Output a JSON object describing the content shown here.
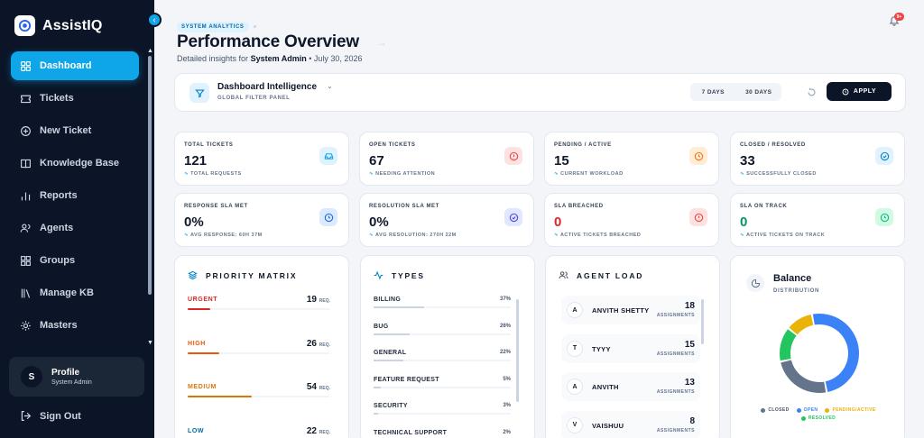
{
  "app": {
    "name": "AssistIQ"
  },
  "sidebar": {
    "items": [
      {
        "label": "Dashboard",
        "icon": "dashboard-icon"
      },
      {
        "label": "Tickets",
        "icon": "ticket-icon"
      },
      {
        "label": "New Ticket",
        "icon": "plus-circle-icon"
      },
      {
        "label": "Knowledge Base",
        "icon": "book-icon"
      },
      {
        "label": "Reports",
        "icon": "bar-chart-icon"
      },
      {
        "label": "Agents",
        "icon": "users-icon"
      },
      {
        "label": "Groups",
        "icon": "grid-icon"
      },
      {
        "label": "Manage KB",
        "icon": "library-icon"
      },
      {
        "label": "Masters",
        "icon": "gear-icon"
      }
    ],
    "profile": {
      "initial": "S",
      "name": "Profile",
      "role": "System Admin"
    },
    "signout": "Sign Out"
  },
  "header": {
    "badge": "SYSTEM ANALYTICS",
    "title": "Performance Overview",
    "subtitle_prefix": "Detailed insights for",
    "subtitle_user": "System Admin",
    "subtitle_date": "• July 30, 2026",
    "notifications": "9+"
  },
  "filter": {
    "title": "Dashboard Intelligence",
    "subtitle": "GLOBAL FILTER PANEL",
    "ranges": [
      "7 DAYS",
      "30 DAYS"
    ],
    "apply": "APPLY"
  },
  "stats": [
    {
      "label": "TOTAL TICKETS",
      "value": "121",
      "sub": "TOTAL REQUESTS",
      "color": "#0ea5e9",
      "bg": "#e0f2fe"
    },
    {
      "label": "OPEN TICKETS",
      "value": "67",
      "sub": "NEEDING ATTENTION",
      "color": "#ef4444",
      "bg": "#fee2e2"
    },
    {
      "label": "PENDING / ACTIVE",
      "value": "15",
      "sub": "CURRENT WORKLOAD",
      "color": "#f97316",
      "bg": "#ffedd5"
    },
    {
      "label": "CLOSED / RESOLVED",
      "value": "33",
      "sub": "SUCCESSFULLY CLOSED",
      "color": "#0284c7",
      "bg": "#e0f2fe"
    },
    {
      "label": "RESPONSE SLA MET",
      "value": "0%",
      "sub": "AVG RESPONSE: 60H 37M",
      "color": "#2563eb",
      "bg": "#dbeafe"
    },
    {
      "label": "RESOLUTION SLA MET",
      "value": "0%",
      "sub": "AVG RESOLUTION: 270H 22M",
      "color": "#4f46e5",
      "bg": "#e0e7ff"
    },
    {
      "label": "SLA BREACHED",
      "value": "0",
      "sub": "ACTIVE TICKETS BREACHED",
      "color": "#ef4444",
      "bg": "#fee2e2",
      "value_color": "#dc2626"
    },
    {
      "label": "SLA ON TRACK",
      "value": "0",
      "sub": "ACTIVE TICKETS ON TRACK",
      "color": "#10b981",
      "bg": "#d1fae5",
      "value_color": "#059669"
    }
  ],
  "priority": {
    "title": "PRIORITY MATRIX",
    "unit": "REQ.",
    "rows": [
      {
        "name": "URGENT",
        "count": "19",
        "color": "#dc2626",
        "fill": 0.16
      },
      {
        "name": "HIGH",
        "count": "26",
        "color": "#ea580c",
        "fill": 0.22
      },
      {
        "name": "MEDIUM",
        "count": "54",
        "color": "#d97706",
        "fill": 0.45
      },
      {
        "name": "LOW",
        "count": "22",
        "color": "#0369a1",
        "fill": 0.18
      }
    ]
  },
  "types": {
    "title": "TYPES",
    "rows": [
      {
        "name": "BILLING",
        "pct": "37%",
        "fill": 0.37
      },
      {
        "name": "BUG",
        "pct": "26%",
        "fill": 0.26
      },
      {
        "name": "GENERAL",
        "pct": "22%",
        "fill": 0.22
      },
      {
        "name": "FEATURE REQUEST",
        "pct": "5%",
        "fill": 0.05
      },
      {
        "name": "SECURITY",
        "pct": "3%",
        "fill": 0.03
      },
      {
        "name": "TECHNICAL SUPPORT",
        "pct": "2%",
        "fill": 0.02
      }
    ]
  },
  "agents": {
    "title": "AGENT LOAD",
    "unit": "ASSIGNMENTS",
    "rows": [
      {
        "initial": "A",
        "name": "ANVITH SHETTY",
        "count": "18"
      },
      {
        "initial": "T",
        "name": "TYYY",
        "count": "15"
      },
      {
        "initial": "A",
        "name": "ANVITH",
        "count": "13"
      },
      {
        "initial": "V",
        "name": "VAISHUU",
        "count": "8"
      }
    ]
  },
  "balance": {
    "title": "Balance",
    "subtitle": "DISTRIBUTION",
    "segments": [
      {
        "name": "CLOSED",
        "value": 33,
        "color": "#64748b"
      },
      {
        "name": "OPEN",
        "value": 67,
        "color": "#3b82f6"
      },
      {
        "name": "PENDING/ACTIVE",
        "value": 15,
        "color": "#eab308"
      },
      {
        "name": "RESOLVED",
        "value": 19,
        "color": "#22c55e"
      }
    ]
  }
}
